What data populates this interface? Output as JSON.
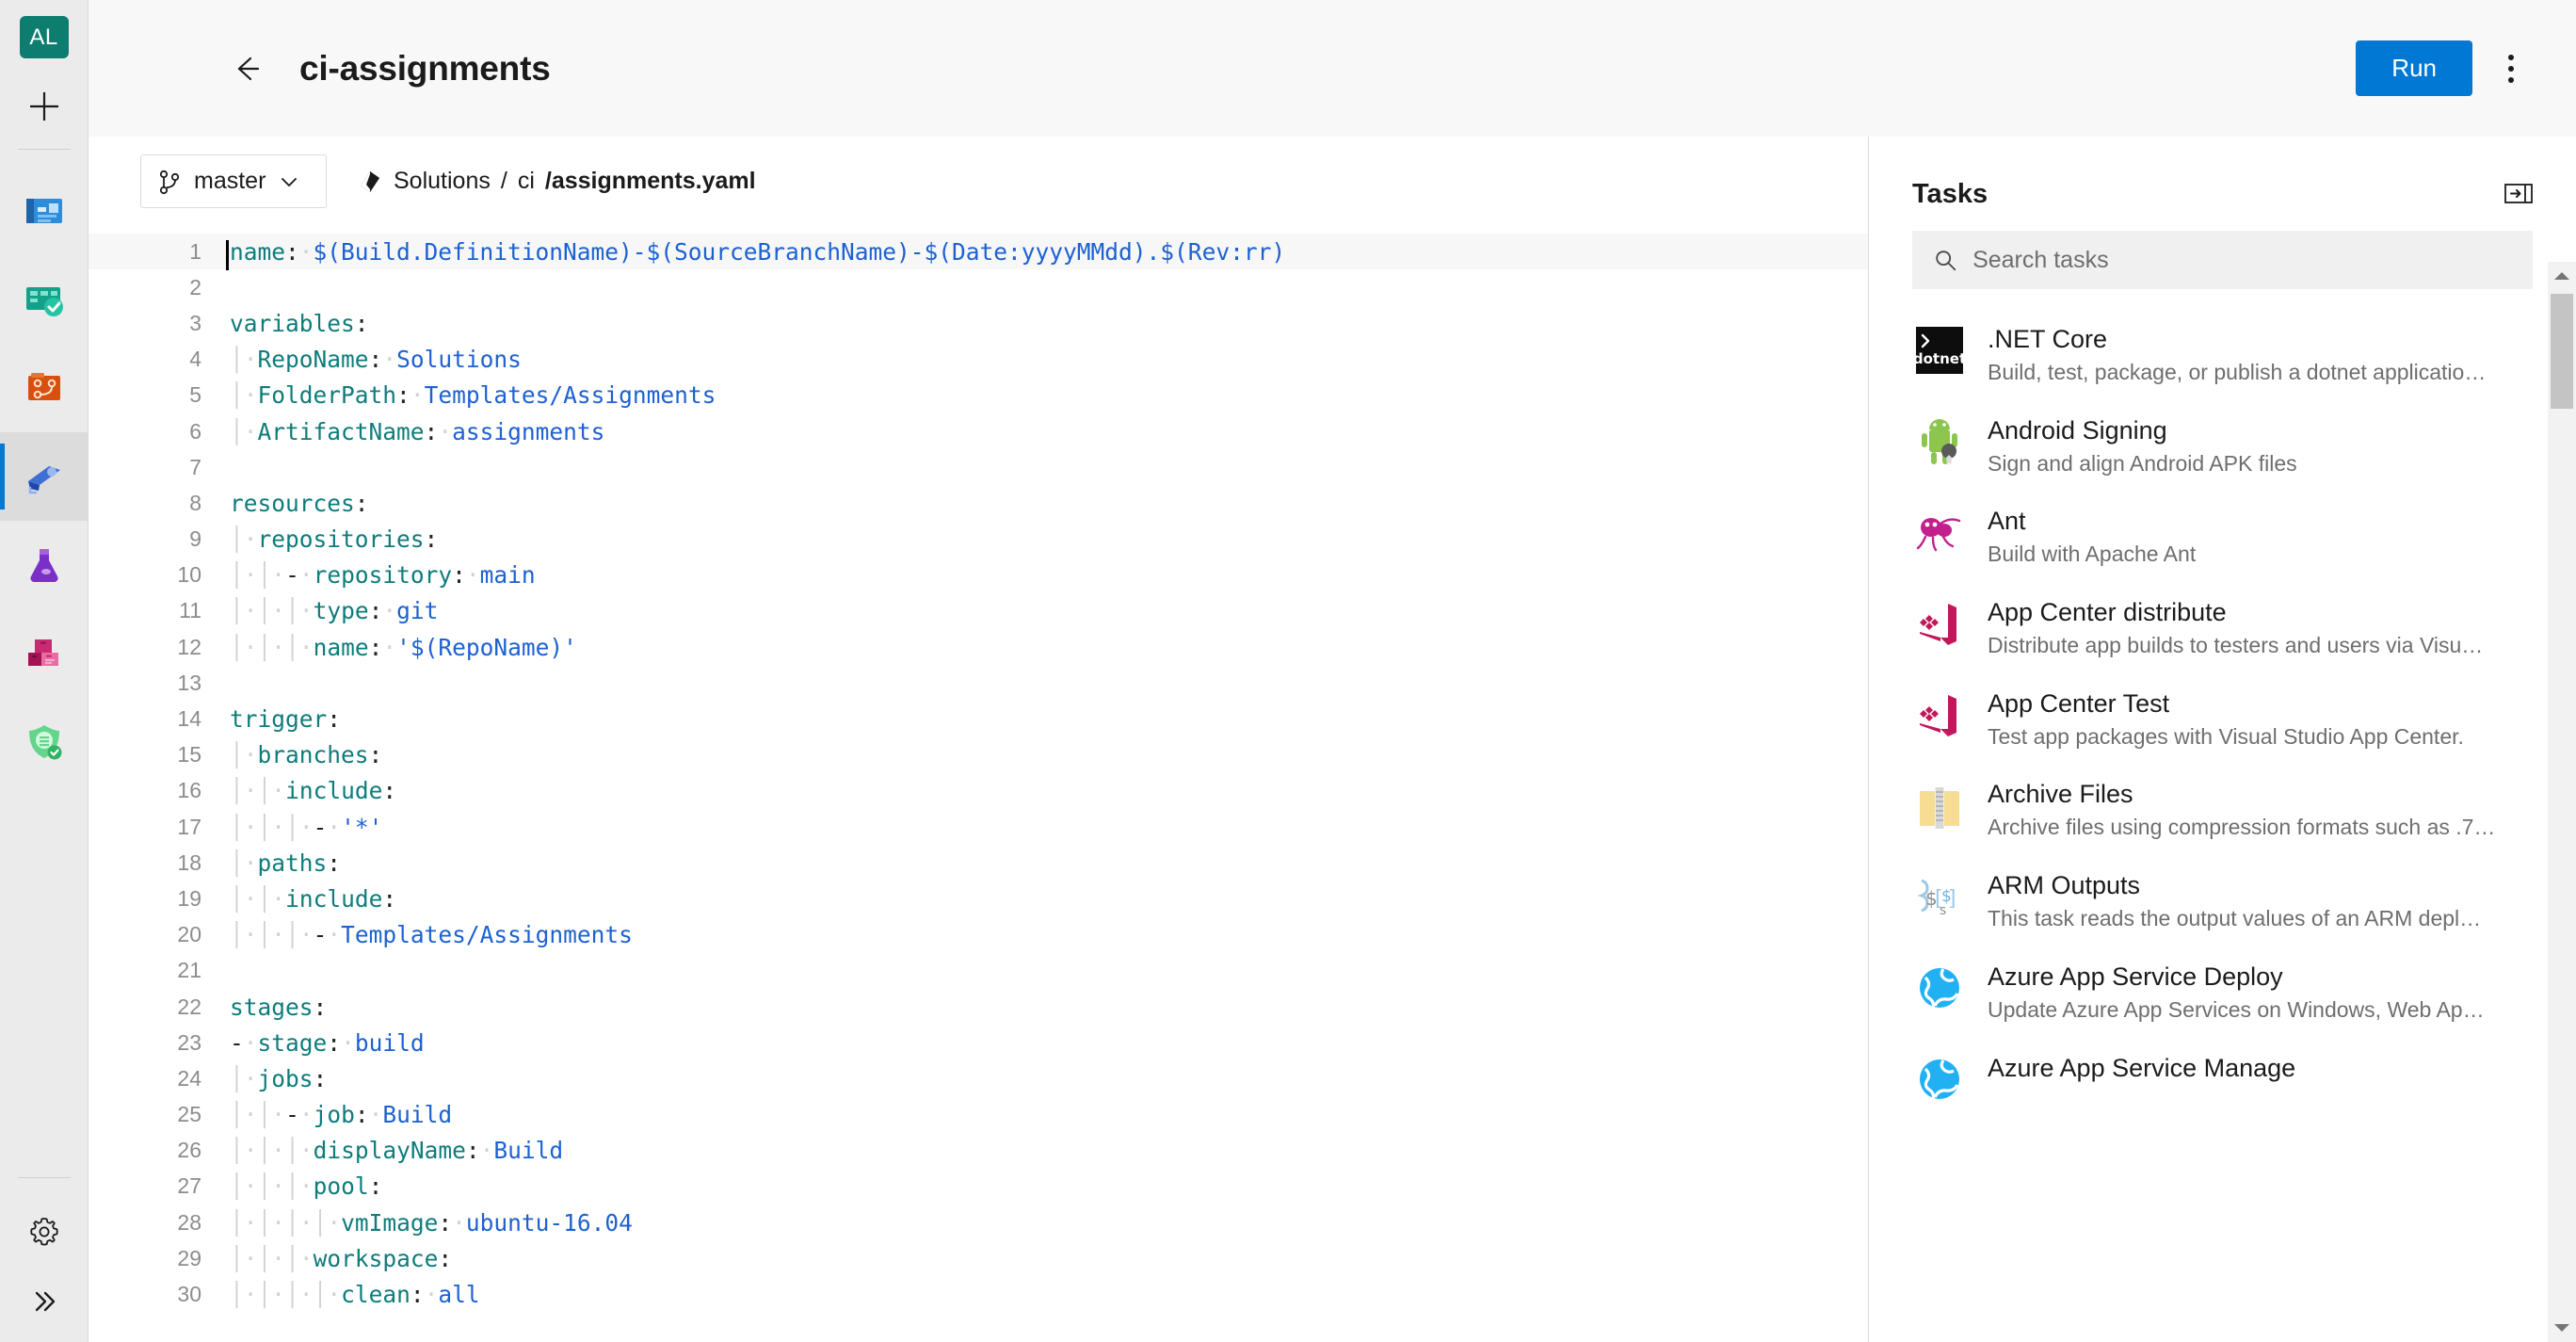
{
  "rail": {
    "avatar_label": "AL",
    "items": [
      {
        "name": "new-item",
        "icon": "plus-icon"
      },
      {
        "name": "overview",
        "icon": "overview-icon"
      },
      {
        "name": "boards",
        "icon": "boards-icon"
      },
      {
        "name": "repos",
        "icon": "repos-icon"
      },
      {
        "name": "pipelines",
        "icon": "pipelines-icon",
        "active": true
      },
      {
        "name": "test-plans",
        "icon": "test-plans-icon"
      },
      {
        "name": "artifacts",
        "icon": "artifacts-icon"
      },
      {
        "name": "security",
        "icon": "security-shield-icon"
      }
    ],
    "settings_icon": "gear-icon",
    "expand_icon": "double-chevron-right-icon"
  },
  "topbar": {
    "back_icon": "arrow-left-icon",
    "title": "ci-assignments",
    "run_label": "Run",
    "more_icon": "more-vertical-icon"
  },
  "editor": {
    "branch": {
      "icon": "branch-icon",
      "name": "master",
      "chevron": "chevron-down-icon"
    },
    "breadcrumb": {
      "repo_icon": "azure-repos-icon",
      "repo": "Solutions",
      "separator": "/",
      "folder": "ci",
      "file": "/assignments.yaml"
    },
    "cursor_line": 1,
    "lines": [
      {
        "n": 1,
        "indent": 0,
        "dash": false,
        "key": "name",
        "value": "$(Build.DefinitionName)-$(SourceBranchName)-$(Date:yyyyMMdd).$(Rev:rr)"
      },
      {
        "n": 2,
        "indent": 0,
        "dash": false,
        "key": "",
        "value": ""
      },
      {
        "n": 3,
        "indent": 0,
        "dash": false,
        "key": "variables",
        "value": ""
      },
      {
        "n": 4,
        "indent": 1,
        "dash": false,
        "key": "RepoName",
        "value": "Solutions"
      },
      {
        "n": 5,
        "indent": 1,
        "dash": false,
        "key": "FolderPath",
        "value": "Templates/Assignments"
      },
      {
        "n": 6,
        "indent": 1,
        "dash": false,
        "key": "ArtifactName",
        "value": "assignments"
      },
      {
        "n": 7,
        "indent": 0,
        "dash": false,
        "key": "",
        "value": ""
      },
      {
        "n": 8,
        "indent": 0,
        "dash": false,
        "key": "resources",
        "value": ""
      },
      {
        "n": 9,
        "indent": 1,
        "dash": false,
        "key": "repositories",
        "value": ""
      },
      {
        "n": 10,
        "indent": 2,
        "dash": true,
        "key": "repository",
        "value": "main"
      },
      {
        "n": 11,
        "indent": 3,
        "dash": false,
        "key": "type",
        "value": "git"
      },
      {
        "n": 12,
        "indent": 3,
        "dash": false,
        "key": "name",
        "value": "'$(RepoName)'",
        "quoted": true
      },
      {
        "n": 13,
        "indent": 0,
        "dash": false,
        "key": "",
        "value": ""
      },
      {
        "n": 14,
        "indent": 0,
        "dash": false,
        "key": "trigger",
        "value": ""
      },
      {
        "n": 15,
        "indent": 1,
        "dash": false,
        "key": "branches",
        "value": ""
      },
      {
        "n": 16,
        "indent": 2,
        "dash": false,
        "key": "include",
        "value": ""
      },
      {
        "n": 17,
        "indent": 3,
        "dash": true,
        "key": "",
        "value": "'*'",
        "quoted": true
      },
      {
        "n": 18,
        "indent": 1,
        "dash": false,
        "key": "paths",
        "value": ""
      },
      {
        "n": 19,
        "indent": 2,
        "dash": false,
        "key": "include",
        "value": ""
      },
      {
        "n": 20,
        "indent": 3,
        "dash": true,
        "key": "",
        "value": "Templates/Assignments"
      },
      {
        "n": 21,
        "indent": 0,
        "dash": false,
        "key": "",
        "value": ""
      },
      {
        "n": 22,
        "indent": 0,
        "dash": false,
        "key": "stages",
        "value": ""
      },
      {
        "n": 23,
        "indent": 0,
        "dash": true,
        "key": "stage",
        "value": "build"
      },
      {
        "n": 24,
        "indent": 1,
        "dash": false,
        "key": "jobs",
        "value": ""
      },
      {
        "n": 25,
        "indent": 2,
        "dash": true,
        "key": "job",
        "value": "Build"
      },
      {
        "n": 26,
        "indent": 3,
        "dash": false,
        "key": "displayName",
        "value": "Build"
      },
      {
        "n": 27,
        "indent": 3,
        "dash": false,
        "key": "pool",
        "value": ""
      },
      {
        "n": 28,
        "indent": 4,
        "dash": false,
        "key": "vmImage",
        "value": "ubuntu-16.04"
      },
      {
        "n": 29,
        "indent": 3,
        "dash": false,
        "key": "workspace",
        "value": ""
      },
      {
        "n": 30,
        "indent": 4,
        "dash": false,
        "key": "clean",
        "value": "all"
      }
    ]
  },
  "tasks": {
    "title": "Tasks",
    "collapse_icon": "collapse-panel-icon",
    "search": {
      "icon": "search-icon",
      "placeholder": "Search tasks",
      "value": ""
    },
    "items": [
      {
        "icon": "dotnet-icon",
        "name": ".NET Core",
        "desc": "Build, test, package, or publish a dotnet applicatio…"
      },
      {
        "icon": "android-signing-icon",
        "name": "Android Signing",
        "desc": "Sign and align Android APK files"
      },
      {
        "icon": "apache-ant-icon",
        "name": "Ant",
        "desc": "Build with Apache Ant"
      },
      {
        "icon": "app-center-icon",
        "name": "App Center distribute",
        "desc": "Distribute app builds to testers and users via Visu…"
      },
      {
        "icon": "app-center-icon",
        "name": "App Center Test",
        "desc": "Test app packages with Visual Studio App Center."
      },
      {
        "icon": "archive-files-icon",
        "name": "Archive Files",
        "desc": "Archive files using compression formats such as .7…"
      },
      {
        "icon": "arm-outputs-icon",
        "name": "ARM Outputs",
        "desc": "This task reads the output values of an ARM depl…"
      },
      {
        "icon": "azure-globe-icon",
        "name": "Azure App Service Deploy",
        "desc": "Update Azure App Services on Windows, Web Ap…"
      },
      {
        "icon": "azure-globe-icon",
        "name": "Azure App Service Manage",
        "desc": ""
      }
    ],
    "scrollbar": {
      "up_icon": "scroll-up-arrow-icon",
      "down_icon": "scroll-down-arrow-icon"
    }
  },
  "colors": {
    "accent": "#0078d4",
    "avatar_bg": "#0d7d6f",
    "yaml_key": "#0e7c7b",
    "yaml_value": "#1d61d1",
    "rail_bg": "#ebebeb"
  }
}
